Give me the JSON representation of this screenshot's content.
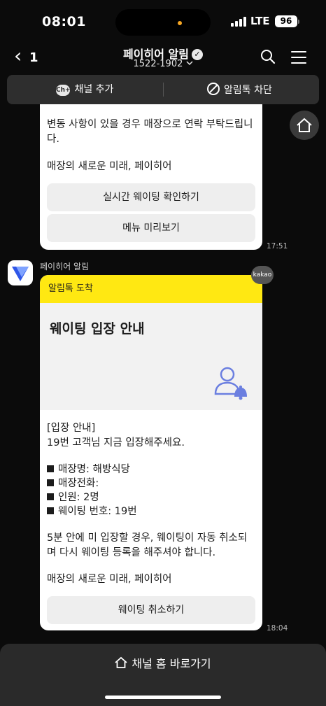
{
  "status": {
    "time": "08:01",
    "network": "LTE",
    "battery": "96"
  },
  "header": {
    "back_count": "1",
    "title": "페이히어 알림",
    "phone": "1522-1902",
    "icons": [
      "back-chevron-icon",
      "verified-check-icon",
      "chevron-down-icon",
      "search-icon",
      "menu-icon"
    ]
  },
  "actions": {
    "add_channel": "채널 추가",
    "add_channel_badge": "Ch+",
    "block": "알림톡 차단"
  },
  "prev_message": {
    "text1": "변동 사항이 있을 경우 매장으로 연락 부탁드립니다.",
    "text2": "매장의 새로운 미래, 페이히어",
    "button1": "실시간 웨이팅 확인하기",
    "button2": "메뉴 미리보기",
    "time": "17:51"
  },
  "message": {
    "sender": "페이히어 알림",
    "badge": "kakao",
    "head": "알림톡 도착",
    "title": "웨이팅 입장 안내",
    "intro_label": "[입장 안내]",
    "intro": "19번 고객님 지금 입장해주세요.",
    "items": [
      "매장명: 해방식당",
      "매장전화:",
      "인원: 2명",
      "웨이팅 번호: 19번"
    ],
    "notice": "5분 안에 미 입장할 경우, 웨이팅이 자동 취소되며 다시 웨이팅 등록을 해주셔야 합니다.",
    "footer": "매장의 새로운 미래, 페이히어",
    "button": "웨이팅 취소하기",
    "time": "18:04"
  },
  "bottom": {
    "label": "채널 홈 바로가기"
  },
  "colors": {
    "accent_yellow": "#ffe812",
    "icon_blue": "#6b7fe0",
    "bg": "#0b0b0b"
  }
}
